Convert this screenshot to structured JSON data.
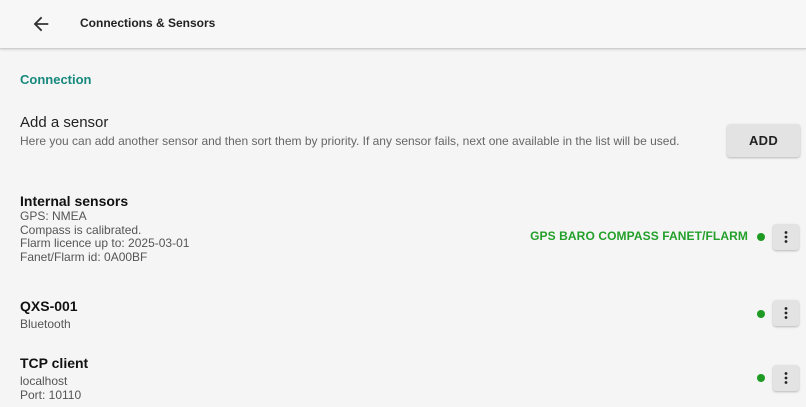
{
  "header": {
    "title": "Connections & Sensors",
    "back_icon": "arrow-left-icon"
  },
  "section": {
    "title": "Connection"
  },
  "add_sensor": {
    "title": "Add a sensor",
    "description": "Here you can add another sensor and then sort them by priority. If any sensor fails, next one available in the list will be used.",
    "button_label": "ADD"
  },
  "sensors": [
    {
      "name": "Internal sensors",
      "details": [
        "GPS: NMEA",
        "Compass is calibrated.",
        "Flarm licence up to: 2025-03-01",
        "Fanet/Flarm id: 0A00BF"
      ],
      "capabilities": "GPS BARO COMPASS FANET/FLARM",
      "status": "connected"
    },
    {
      "name": "QXS-001",
      "details": [
        "Bluetooth"
      ],
      "status": "connected"
    },
    {
      "name": "TCP client",
      "details": [
        "localhost",
        "Port: 10110"
      ],
      "status": "connected"
    }
  ],
  "colors": {
    "accent": "#17897d",
    "status_ok": "#1f9a22",
    "capabilities": "#23a02a",
    "button_bg": "#e3e3e3"
  },
  "icons": {
    "more": "more-vertical-icon",
    "status": "status-dot-icon"
  }
}
